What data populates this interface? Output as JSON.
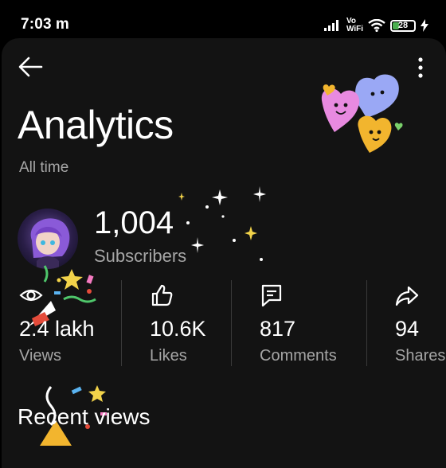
{
  "status_bar": {
    "time": "7:03",
    "notification_letter": "m",
    "volte_line1": "Vo",
    "volte_line2": "WiFi",
    "battery_level": "28"
  },
  "header": {
    "title": "Analytics",
    "period": "All time"
  },
  "channel": {
    "subscriber_count": "1,004",
    "subscriber_label": "Subscribers"
  },
  "stats": [
    {
      "value": "2.4 lakh",
      "label": "Views",
      "icon": "eye-icon"
    },
    {
      "value": "10.6K",
      "label": "Likes",
      "icon": "thumbs-up-icon"
    },
    {
      "value": "817",
      "label": "Comments",
      "icon": "comment-icon"
    },
    {
      "value": "94",
      "label": "Shares",
      "icon": "share-icon"
    }
  ],
  "section": {
    "recent_views_title": "Recent views"
  },
  "colors": {
    "background": "#000000",
    "panel": "#131313",
    "secondary_text": "#a6a6a6",
    "divider": "#3a3a3a"
  }
}
